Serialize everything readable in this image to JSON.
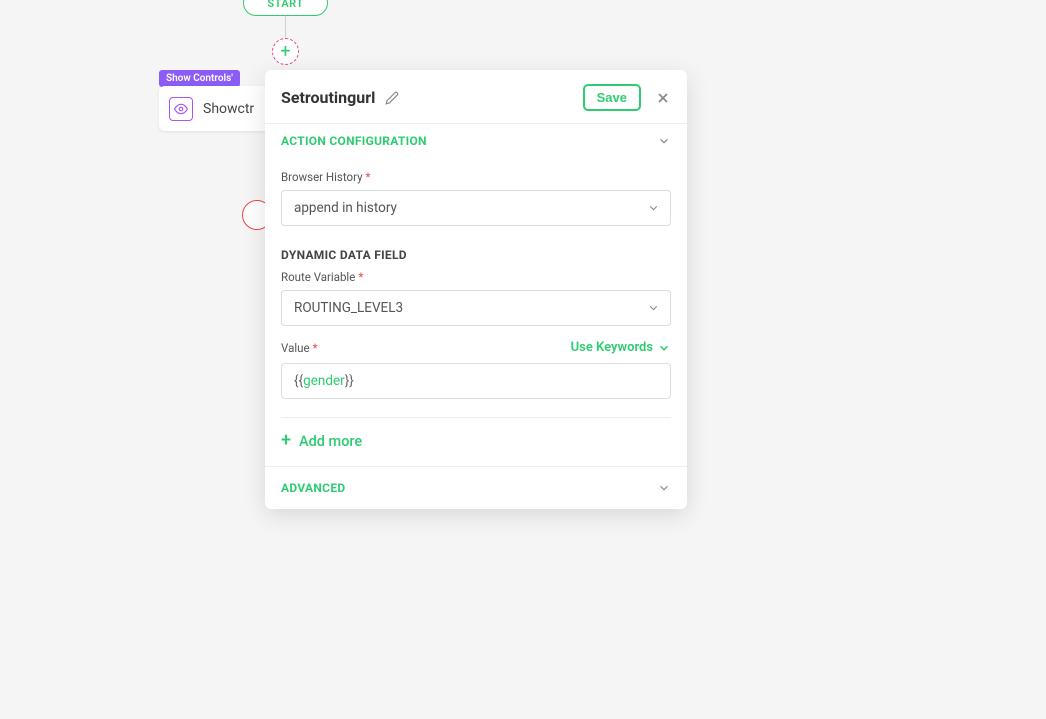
{
  "flow": {
    "start_label": "START",
    "tag_label": "Show Controls'",
    "snippet_label": "Showctr"
  },
  "panel": {
    "title": "Setroutingurl",
    "save_label": "Save",
    "sections": {
      "action_config_title": "ACTION CONFIGURATION",
      "dynamic_data_title": "DYNAMIC DATA FIELD",
      "advanced_title": "ADVANCED"
    },
    "fields": {
      "browser_history_label": "Browser History",
      "browser_history_value": "append in history",
      "route_variable_label": "Route Variable",
      "route_variable_value": "ROUTING_LEVEL3",
      "value_label": "Value",
      "use_keywords_label": "Use Keywords",
      "value_input_prefix": "{{",
      "value_input_keyword": "gender",
      "value_input_suffix": "}}",
      "add_more_label": "Add more"
    }
  }
}
